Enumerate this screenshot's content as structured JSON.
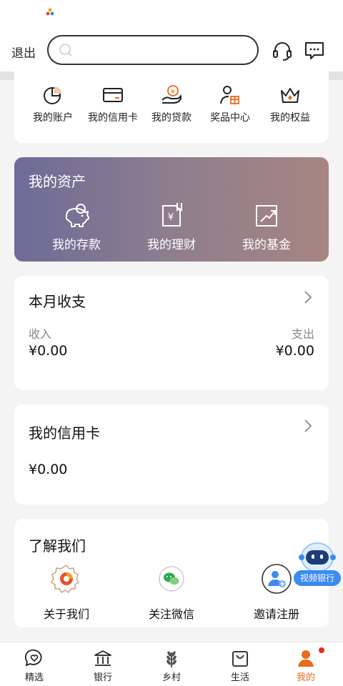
{
  "colors": {
    "accent": "#e86a1a",
    "assets_gradient_start": "#6d6b98",
    "assets_gradient_end": "#a88582",
    "badge": "#e52d1f",
    "robot_blue": "#3b8bf0"
  },
  "header": {
    "exit_label": "退出",
    "search_placeholder": "",
    "support_icon": "headset-icon",
    "message_icon": "message-icon"
  },
  "quick_menu": [
    {
      "label": "我的账户",
      "icon": "pie-chart-icon"
    },
    {
      "label": "我的信用卡",
      "icon": "credit-card-icon"
    },
    {
      "label": "我的贷款",
      "icon": "loan-hand-icon"
    },
    {
      "label": "奖品中心",
      "icon": "gift-user-icon"
    },
    {
      "label": "我的权益",
      "icon": "crown-icon"
    }
  ],
  "assets": {
    "title": "我的资产",
    "items": [
      {
        "label": "我的存款",
        "icon": "piggy-bank-icon"
      },
      {
        "label": "我的理财",
        "icon": "finance-doc-icon"
      },
      {
        "label": "我的基金",
        "icon": "fund-chart-icon"
      }
    ]
  },
  "monthly": {
    "title": "本月收支",
    "income_label": "收入",
    "income_value": "¥0.00",
    "expense_label": "支出",
    "expense_value": "¥0.00"
  },
  "credit_card": {
    "title": "我的信用卡",
    "amount": "¥0.00"
  },
  "about": {
    "title": "了解我们",
    "items": [
      {
        "label": "关于我们",
        "icon": "bank-logo-icon"
      },
      {
        "label": "关注微信",
        "icon": "wechat-icon"
      },
      {
        "label": "邀请注册",
        "icon": "invite-user-icon"
      }
    ]
  },
  "video_bank": {
    "label": "视频银行"
  },
  "tabs": [
    {
      "label": "精选",
      "icon": "heart-chat-icon"
    },
    {
      "label": "银行",
      "icon": "bank-building-icon"
    },
    {
      "label": "乡村",
      "icon": "wheat-icon"
    },
    {
      "label": "生活",
      "icon": "shopping-bag-icon"
    },
    {
      "label": "我的",
      "icon": "profile-icon",
      "active": true
    }
  ]
}
